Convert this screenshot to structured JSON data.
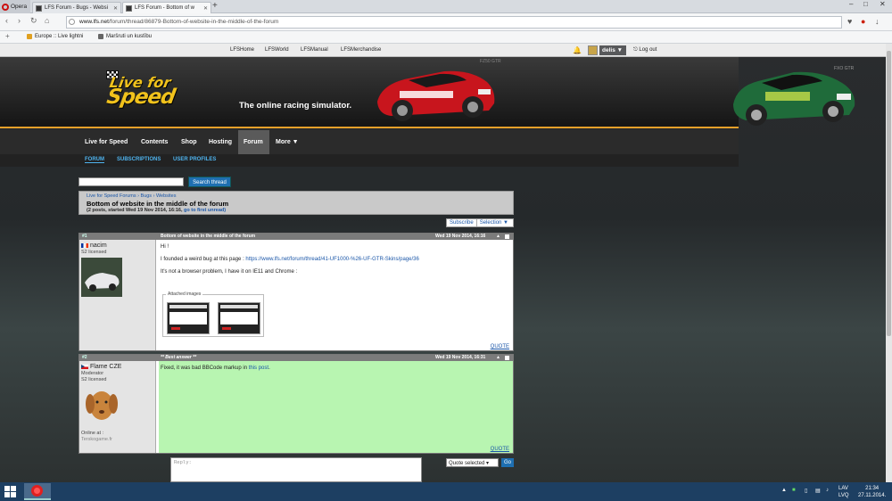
{
  "browser": {
    "menu_label": "Opera",
    "tabs": [
      {
        "title": "LFS Forum - Bugs - Websi"
      },
      {
        "title": "LFS Forum - Bottom of w"
      }
    ],
    "url_host": "www.lfs.net",
    "url_path": "/forum/thread/86879-Bottom-of-website-in-the-middle-of-the-forum",
    "bookmarks": [
      {
        "label": "Europe :: Live lightni"
      },
      {
        "label": "Maršruti un kustību"
      }
    ]
  },
  "site_links": [
    "LFSHome",
    "LFSWorld",
    "LFSManual",
    "LFSMerchandise"
  ],
  "account": {
    "username": "delis",
    "logout_label": "Log out"
  },
  "header": {
    "logo_line1": "Live for",
    "logo_line2": "Speed",
    "tagline": "The online racing simulator.",
    "car1_label": "FZ50 GTR",
    "car2_label": "FXO GTR"
  },
  "main_nav": [
    "Live for Speed",
    "Contents",
    "Shop",
    "Hosting",
    "Forum",
    "More ▼"
  ],
  "sub_nav": [
    "FORUM",
    "SUBSCRIPTIONS",
    "USER PROFILES"
  ],
  "search": {
    "button_label": "Search thread"
  },
  "thread": {
    "breadcrumb": "Live for Speed Forums › Bugs › Websites",
    "title": "Bottom of website in the middle of the forum",
    "meta": "(2 posts, started Wed 19 Nov 2014, 16:16,",
    "meta_link": "go to first unread)",
    "subscribe_label": "Subscribe",
    "selection_label": "Selection ▼"
  },
  "posts": [
    {
      "number": "#1",
      "title": "Bottom of website in the middle of the forum",
      "date": "Wed 19 Nov 2014, 16:16",
      "author": "nacim",
      "role": "S2 licensed",
      "line1": "Hi !",
      "line2_prefix": "I founded a weird bug at this page :",
      "line2_link": "https://www.lfs.net/forum/thread/41-UF1000-%26-UF-GTR-Skins/page/36",
      "line3": "It's not a browser problem, I have it on IE11 and Chrome :",
      "attached_label": "Attached images",
      "quote_label": "QUOTE"
    },
    {
      "number": "#2",
      "title": "** Best answer **",
      "date": "Wed 19 Nov 2014, 16:31",
      "author": "Flame CZE",
      "role1": "Moderator",
      "role2": "S2 licensed",
      "online_label": "Online at :",
      "online_value": "Terskogame.fr",
      "text_prefix": "Fixed, it was bad BBCode markup in",
      "text_link": "this post",
      "text_suffix": ".",
      "quote_label": "QUOTE"
    }
  ],
  "reply": {
    "placeholder": "Reply:",
    "quote_select": "Quote selected",
    "go_label": "Go"
  },
  "taskbar": {
    "lang1": "LAV",
    "lang2": "LVQ",
    "time": "21:34",
    "date": "27.11.2014."
  },
  "colors": {
    "accent": "#e5a02a",
    "link": "#4fb4ef",
    "button": "#1e6fb1",
    "best_answer_bg": "#b8f5b1"
  }
}
